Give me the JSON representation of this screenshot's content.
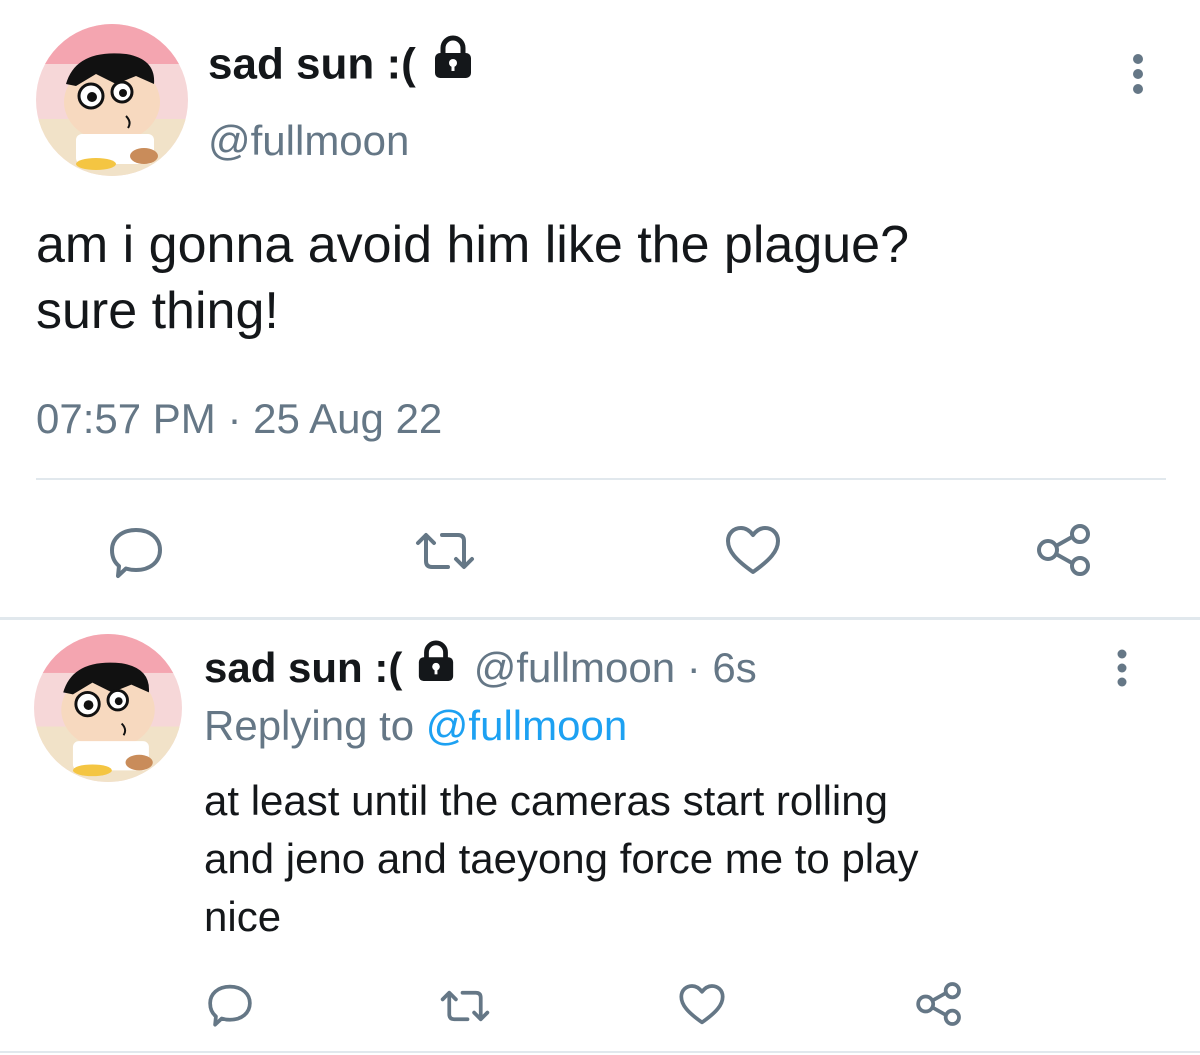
{
  "main_tweet": {
    "display_name": "sad sun :(",
    "handle": "@fullmoon",
    "text_line1": "am i gonna avoid him like the plague?",
    "text_line2": "sure thing!",
    "timestamp": "07:57 PM · 25 Aug 22",
    "more_icon": "more-vertical-icon",
    "lock_icon": "lock-icon"
  },
  "actions": {
    "reply_icon": "reply-icon",
    "retweet_icon": "retweet-icon",
    "like_icon": "like-icon",
    "share_icon": "share-icon"
  },
  "reply_tweet": {
    "display_name": "sad sun :(",
    "handle_time": "@fullmoon · 6s",
    "replying_to_prefix": "Replying to ",
    "replying_to_handle": "@fullmoon",
    "text_line1": "at least until the cameras start rolling",
    "text_line2": "and jeno and taeyong force me to play",
    "text_line3": "nice"
  },
  "colors": {
    "text": "#14171a",
    "muted": "#657786",
    "link": "#1da1f2",
    "divider": "#e1e8ed",
    "icon": "#657786"
  }
}
